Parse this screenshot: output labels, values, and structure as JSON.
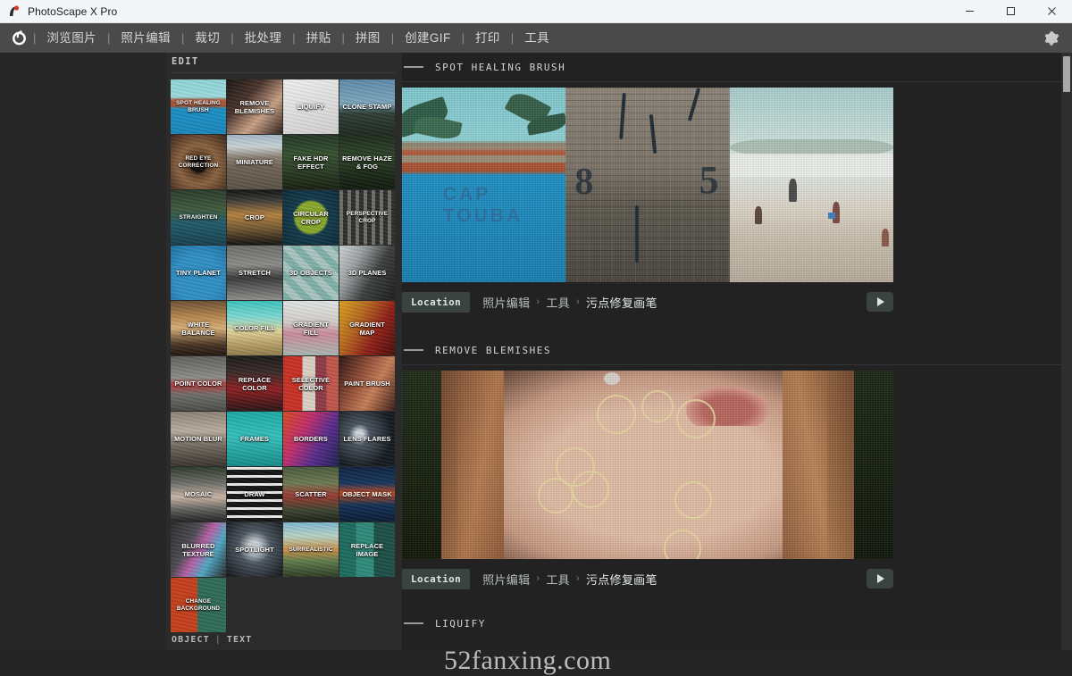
{
  "window": {
    "title": "PhotoScape X Pro",
    "logo_icon": "photoscape-logo-icon",
    "minimize_icon": "minimize-icon",
    "maximize_icon": "maximize-icon",
    "close_icon": "close-icon"
  },
  "menubar": {
    "logo_icon": "app-mark-icon",
    "separator": "|",
    "items": [
      {
        "label": "浏览图片",
        "name": "menu-browse-photos"
      },
      {
        "label": "照片编辑",
        "name": "menu-photo-editor"
      },
      {
        "label": "裁切",
        "name": "menu-cutout"
      },
      {
        "label": "批处理",
        "name": "menu-batch"
      },
      {
        "label": "拼贴",
        "name": "menu-collage"
      },
      {
        "label": "拼图",
        "name": "menu-combine"
      },
      {
        "label": "创建GIF",
        "name": "menu-create-gif"
      },
      {
        "label": "打印",
        "name": "menu-print"
      },
      {
        "label": "工具",
        "name": "menu-tools"
      }
    ],
    "settings_icon": "gear-icon"
  },
  "palette": {
    "heading": "EDIT",
    "footer": {
      "object": "OBJECT",
      "separator": "|",
      "text": "TEXT"
    },
    "tiles": [
      {
        "label": "SPOT HEALING BRUSH",
        "skin": "g-beach",
        "small": true
      },
      {
        "label": "REMOVE BLEMISHES",
        "skin": "g-skin",
        "small": false
      },
      {
        "label": "LIQUIFY",
        "skin": "g-white",
        "small": false
      },
      {
        "label": "CLONE STAMP",
        "skin": "g-tower",
        "small": false
      },
      {
        "label": "RED EYE CORRECTION",
        "skin": "g-eye",
        "small": true
      },
      {
        "label": "MINIATURE",
        "skin": "g-mini",
        "small": false
      },
      {
        "label": "FAKE HDR EFFECT",
        "skin": "g-hdr",
        "small": false
      },
      {
        "label": "REMOVE HAZE & FOG",
        "skin": "g-haze",
        "small": false
      },
      {
        "label": "STRAIGHTEN",
        "skin": "g-straight",
        "small": true
      },
      {
        "label": "CROP",
        "skin": "g-crop",
        "small": false
      },
      {
        "label": "CIRCULAR CROP",
        "skin": "g-circ",
        "small": false
      },
      {
        "label": "PERSPECTIVE CROP",
        "skin": "g-persp",
        "small": true
      },
      {
        "label": "TINY PLANET",
        "skin": "g-tiny",
        "small": false
      },
      {
        "label": "STRETCH",
        "skin": "g-stretch",
        "small": false
      },
      {
        "label": "3D OBJECTS",
        "skin": "g-3dobj",
        "small": false
      },
      {
        "label": "3D PLANES",
        "skin": "g-3dpl",
        "small": false
      },
      {
        "label": "WHITE BALANCE",
        "skin": "g-wb",
        "small": false
      },
      {
        "label": "COLOR FILL",
        "skin": "g-cfill",
        "small": false
      },
      {
        "label": "GRADIENT FILL",
        "skin": "g-gfill",
        "small": false
      },
      {
        "label": "GRADIENT MAP",
        "skin": "g-gmap",
        "small": false
      },
      {
        "label": "POINT COLOR",
        "skin": "g-point",
        "small": false
      },
      {
        "label": "REPLACE COLOR",
        "skin": "g-repl",
        "small": false
      },
      {
        "label": "SELECTIVE COLOR",
        "skin": "g-sel",
        "small": false
      },
      {
        "label": "PAINT BRUSH",
        "skin": "g-paint",
        "small": false
      },
      {
        "label": "MOTION BLUR",
        "skin": "g-motion",
        "small": false
      },
      {
        "label": "FRAMES",
        "skin": "g-frames",
        "small": false
      },
      {
        "label": "BORDERS",
        "skin": "g-borders",
        "small": false
      },
      {
        "label": "LENS FLARES",
        "skin": "g-lens",
        "small": false
      },
      {
        "label": "MOSAIC",
        "skin": "g-mosaic",
        "small": false
      },
      {
        "label": "DRAW",
        "skin": "g-draw",
        "small": false
      },
      {
        "label": "SCATTER",
        "skin": "g-scatter",
        "small": false
      },
      {
        "label": "OBJECT MASK",
        "skin": "g-objmask",
        "small": false
      },
      {
        "label": "BLURRED TEXTURE",
        "skin": "g-blurtex",
        "small": false
      },
      {
        "label": "SPOTLIGHT",
        "skin": "g-spot",
        "small": false
      },
      {
        "label": "SURREALISTIC",
        "skin": "g-surr",
        "small": true
      },
      {
        "label": "REPLACE IMAGE",
        "skin": "g-replimg",
        "small": false
      },
      {
        "label": "CHANGE BACKGROUND",
        "skin": "g-chgbg",
        "small": true
      }
    ]
  },
  "content": {
    "sections": [
      {
        "title": "SPOT HEALING BRUSH",
        "location": {
          "chip": "Location",
          "crumbs": [
            "照片编辑",
            "工具",
            "污点修复画笔"
          ],
          "separator": "›",
          "play_icon": "play-icon"
        }
      },
      {
        "title": "REMOVE BLEMISHES",
        "location": {
          "chip": "Location",
          "crumbs": [
            "照片编辑",
            "工具",
            "污点修复画笔"
          ],
          "separator": "›",
          "play_icon": "play-icon"
        }
      },
      {
        "title": "LIQUIFY",
        "location": null
      }
    ],
    "preview_labels": {
      "cap_sign": "CAP TOUBA",
      "wall_digit_left": "8",
      "wall_digit_right": "5"
    }
  },
  "watermark": "52fanxing.com",
  "colors": {
    "titlebar_bg": "#f3f6f8",
    "menubar_bg": "#4a4a4a",
    "workspace_bg": "#262626",
    "palette_bg": "#2b2b2b",
    "content_bg": "#222222",
    "chip_bg": "#3b4340",
    "scrollbar_thumb": "#a8a8a8",
    "blemish_circle": "#e8d7a0"
  },
  "scrollbar": {
    "position": "top"
  }
}
